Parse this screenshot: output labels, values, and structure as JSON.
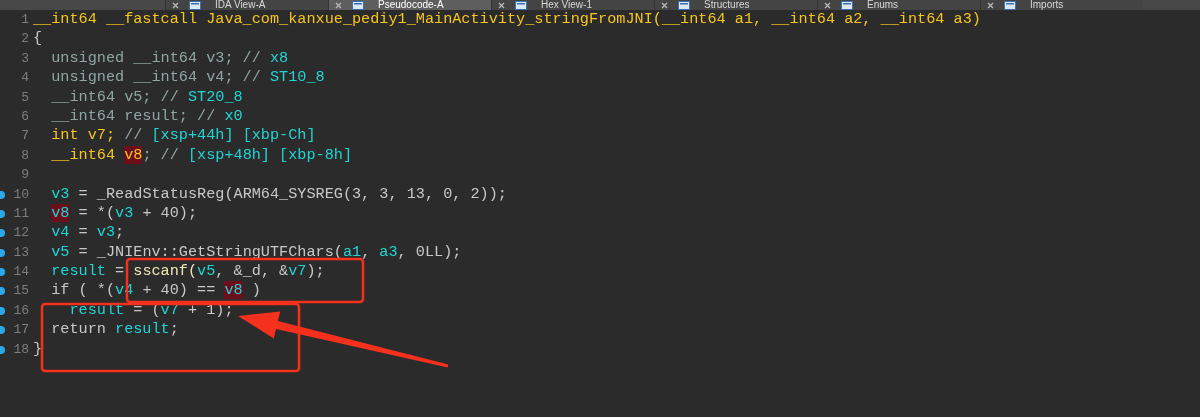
{
  "tabs": [
    {
      "label": "IDA View-A",
      "selected": false
    },
    {
      "label": "Pseudocode-A",
      "selected": true
    },
    {
      "label": "Hex View-1",
      "selected": false
    },
    {
      "label": "Structures",
      "selected": false
    },
    {
      "label": "Enums",
      "selected": false
    },
    {
      "label": "Imports",
      "selected": false
    }
  ],
  "lines": [
    {
      "number": "1",
      "breakpoint": false,
      "tokens": [
        {
          "text": "__int64 __fastcall Java_com_kanxue_pediy1_MainActivity_stringFromJNI(__int64 a1, __int64 a2, __int64 a3)",
          "kind": "keyword"
        }
      ]
    },
    {
      "number": "2",
      "breakpoint": false,
      "tokens": [
        {
          "text": "{",
          "kind": "plain"
        }
      ]
    },
    {
      "number": "3",
      "breakpoint": false,
      "tokens": [
        {
          "text": "  unsigned __int64 v3; // ",
          "kind": "type"
        },
        {
          "text": "x8",
          "kind": "var"
        }
      ]
    },
    {
      "number": "4",
      "breakpoint": false,
      "tokens": [
        {
          "text": "  unsigned __int64 v4; // ",
          "kind": "type"
        },
        {
          "text": "ST10_8",
          "kind": "var"
        }
      ]
    },
    {
      "number": "5",
      "breakpoint": false,
      "tokens": [
        {
          "text": "  __int64 v5; // ",
          "kind": "type"
        },
        {
          "text": "ST20_8",
          "kind": "var"
        }
      ]
    },
    {
      "number": "6",
      "breakpoint": false,
      "tokens": [
        {
          "text": "  __int64 result; // ",
          "kind": "type"
        },
        {
          "text": "x0",
          "kind": "var"
        }
      ]
    },
    {
      "number": "7",
      "breakpoint": false,
      "tokens": [
        {
          "text": "  int v7;",
          "kind": "keyword"
        },
        {
          "text": " // ",
          "kind": "type"
        },
        {
          "text": "[xsp+44h] [xbp-Ch]",
          "kind": "var"
        }
      ]
    },
    {
      "number": "8",
      "breakpoint": false,
      "tokens": [
        {
          "text": "  __int64 ",
          "kind": "keyword"
        },
        {
          "text": "v8",
          "kind": "keyword-highlight"
        },
        {
          "text": "; // ",
          "kind": "type"
        },
        {
          "text": "[xsp+48h] [xbp-8h]",
          "kind": "var"
        }
      ]
    },
    {
      "number": "9",
      "breakpoint": false
    },
    {
      "number": "10",
      "breakpoint": true,
      "tokens": [
        {
          "text": "  v3",
          "kind": "var"
        },
        {
          "text": " = _ReadStatusReg(ARM64_SYSREG(3, 3, 13, 0, 2));",
          "kind": "plain"
        }
      ]
    },
    {
      "number": "11",
      "breakpoint": true,
      "tokens": [
        {
          "text": "  v8",
          "kind": "var-highlight"
        },
        {
          "text": " = *(",
          "kind": "plain"
        },
        {
          "text": "v3",
          "kind": "var"
        },
        {
          "text": " + 40);",
          "kind": "plain"
        }
      ]
    },
    {
      "number": "12",
      "breakpoint": true,
      "tokens": [
        {
          "text": "  v4",
          "kind": "var"
        },
        {
          "text": " = ",
          "kind": "plain"
        },
        {
          "text": "v3",
          "kind": "var"
        },
        {
          "text": ";",
          "kind": "plain"
        }
      ]
    },
    {
      "number": "13",
      "breakpoint": true,
      "tokens": [
        {
          "text": "  v5",
          "kind": "var"
        },
        {
          "text": " = _JNIEnv::GetStringUTFChars(",
          "kind": "plain"
        },
        {
          "text": "a1",
          "kind": "var"
        },
        {
          "text": ", ",
          "kind": "plain"
        },
        {
          "text": "a3",
          "kind": "var"
        },
        {
          "text": ", 0LL);",
          "kind": "plain"
        }
      ]
    },
    {
      "number": "14",
      "breakpoint": true,
      "tokens": [
        {
          "text": "  result",
          "kind": "var"
        },
        {
          "text": " = ",
          "kind": "plain"
        },
        {
          "text": "sscanf(",
          "kind": "func"
        },
        {
          "text": "v5",
          "kind": "var"
        },
        {
          "text": ", &_d, &",
          "kind": "plain"
        },
        {
          "text": "v7",
          "kind": "var"
        },
        {
          "text": ");",
          "kind": "plain"
        }
      ]
    },
    {
      "number": "15",
      "breakpoint": true,
      "tokens": [
        {
          "text": "  if ( *(",
          "kind": "plain"
        },
        {
          "text": "v4",
          "kind": "var"
        },
        {
          "text": " + 40) == ",
          "kind": "plain"
        },
        {
          "text": "v8",
          "kind": "var-highlight"
        },
        {
          "text": " )",
          "kind": "plain"
        }
      ]
    },
    {
      "number": "16",
      "breakpoint": true,
      "tokens": [
        {
          "text": "    result",
          "kind": "var"
        },
        {
          "text": " = (",
          "kind": "plain"
        },
        {
          "text": "v7",
          "kind": "var"
        },
        {
          "text": " + 1);",
          "kind": "plain"
        }
      ]
    },
    {
      "number": "17",
      "breakpoint": true,
      "tokens": [
        {
          "text": "  return ",
          "kind": "plain"
        },
        {
          "text": "result",
          "kind": "var"
        },
        {
          "text": ";",
          "kind": "plain"
        }
      ]
    },
    {
      "number": "18",
      "breakpoint": true,
      "tokens": [
        {
          "text": "}",
          "kind": "plain"
        }
      ]
    }
  ]
}
